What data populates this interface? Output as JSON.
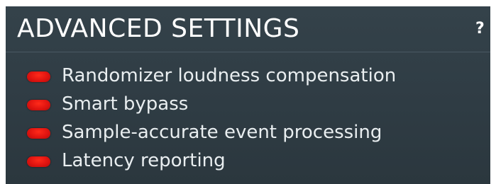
{
  "panel": {
    "title": "ADVANCED SETTINGS",
    "help_label": "?"
  },
  "settings": [
    {
      "label": "Randomizer loudness compensation",
      "state": "off",
      "indicator_color": "#e01410"
    },
    {
      "label": "Smart bypass",
      "state": "off",
      "indicator_color": "#e01410"
    },
    {
      "label": "Sample-accurate event processing",
      "state": "off",
      "indicator_color": "#e01410"
    },
    {
      "label": "Latency reporting",
      "state": "off",
      "indicator_color": "#e01410"
    }
  ],
  "colors": {
    "panel_background": "#2f3c44",
    "text": "#e9eef0",
    "indicator": "#e01410"
  }
}
